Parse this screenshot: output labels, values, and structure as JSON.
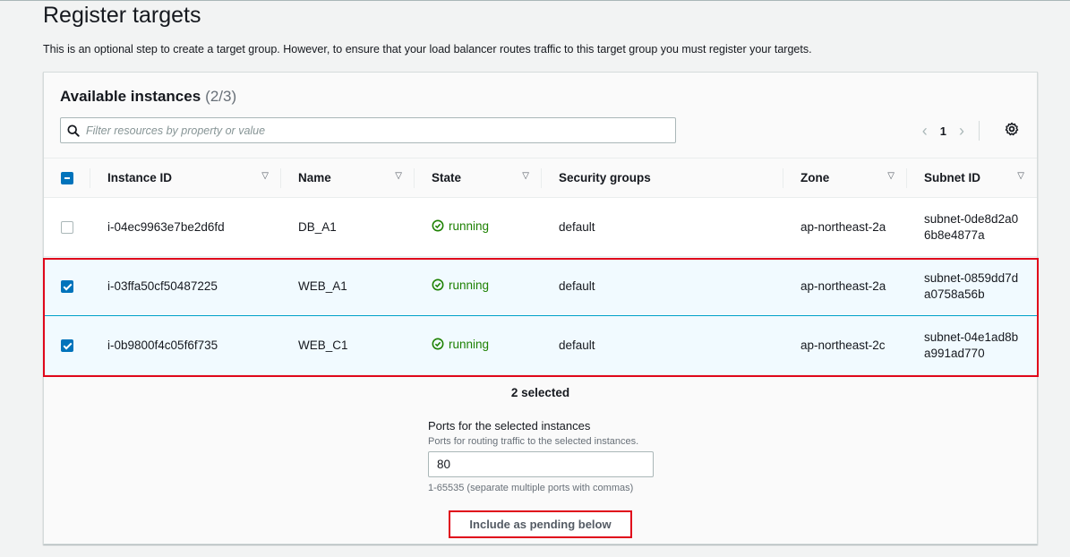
{
  "page": {
    "title": "Register targets",
    "description": "This is an optional step to create a target group. However, to ensure that your load balancer routes traffic to this target group you must register your targets."
  },
  "instances_panel": {
    "title": "Available instances",
    "count": "(2/3)",
    "filter_placeholder": "Filter resources by property or value",
    "current_page": "1",
    "columns": [
      "Instance ID",
      "Name",
      "State",
      "Security groups",
      "Zone",
      "Subnet ID"
    ],
    "rows": [
      {
        "selected": false,
        "instance_id": "i-04ec9963e7be2d6fd",
        "name": "DB_A1",
        "state": "running",
        "security_groups": "default",
        "zone": "ap-northeast-2a",
        "subnet_id": "subnet-0de8d2a06b8e4877a"
      },
      {
        "selected": true,
        "instance_id": "i-03ffa50cf50487225",
        "name": "WEB_A1",
        "state": "running",
        "security_groups": "default",
        "zone": "ap-northeast-2a",
        "subnet_id": "subnet-0859dd7da0758a56b"
      },
      {
        "selected": true,
        "instance_id": "i-0b9800f4c05f6f735",
        "name": "WEB_C1",
        "state": "running",
        "security_groups": "default",
        "zone": "ap-northeast-2c",
        "subnet_id": "subnet-04e1ad8ba991ad770"
      }
    ],
    "selected_text": "2 selected"
  },
  "ports": {
    "label": "Ports for the selected instances",
    "help": "Ports for routing traffic to the selected instances.",
    "value": "80",
    "constraint": "1-65535 (separate multiple ports with commas)"
  },
  "include_button": "Include as pending below",
  "colors": {
    "running": "#1d8102",
    "primary": "#0073bb",
    "highlight": "#e0071b"
  }
}
